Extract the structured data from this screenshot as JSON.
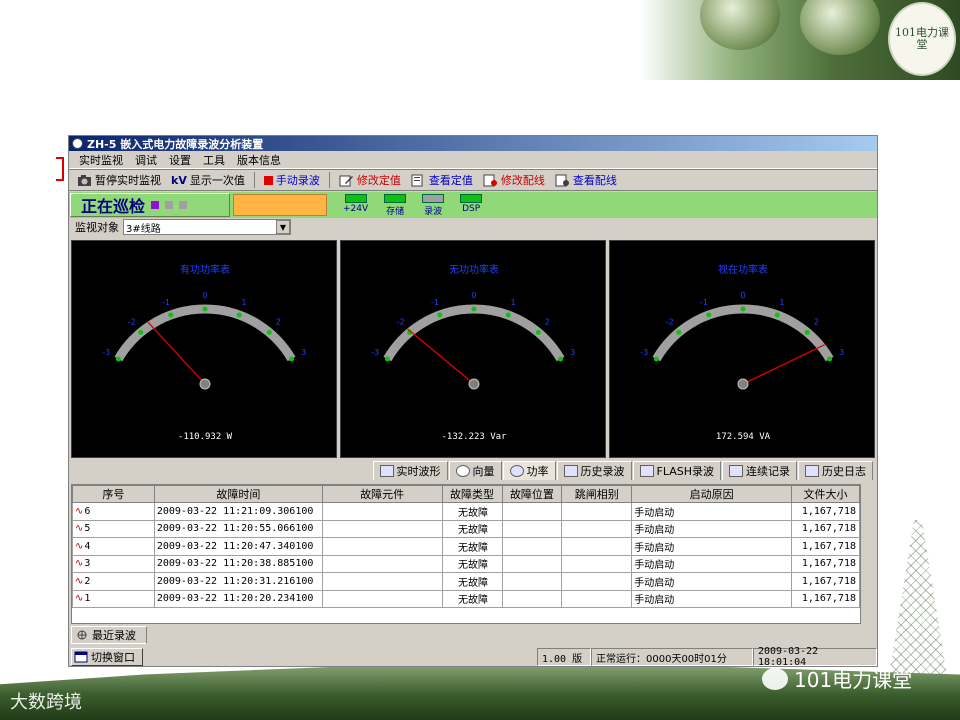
{
  "window": {
    "title": "ZH-5 嵌入式电力故障录波分析装置"
  },
  "menu": [
    "实时监视",
    "调试",
    "设置",
    "工具",
    "版本信息"
  ],
  "toolbar": {
    "pause": "暂停实时监视",
    "display": "显示一次值",
    "display_prefix": "kV",
    "manual_record": "手动录波",
    "edit_setting": "修改定值",
    "view_setting": "查看定值",
    "edit_wiring": "修改配线",
    "view_wiring": "查看配线"
  },
  "status": {
    "patrol": "正在巡检",
    "leds": [
      {
        "label": "+24V",
        "on": true
      },
      {
        "label": "存储",
        "on": true
      },
      {
        "label": "录波",
        "on": false
      },
      {
        "label": "DSP",
        "on": true
      }
    ]
  },
  "monitor": {
    "label": "监视对象",
    "selected": "3#线路"
  },
  "gauges": [
    {
      "title": "有功功率表",
      "value": -110.932,
      "readout": "-110.932 W"
    },
    {
      "title": "无功功率表",
      "value": -132.223,
      "readout": "-132.223 Var"
    },
    {
      "title": "视在功率表",
      "value": 172.594,
      "readout": "172.594 VA"
    }
  ],
  "gauge_ticks": [
    "-3",
    "-2",
    "-1",
    "0",
    "1",
    "2",
    "3"
  ],
  "tabs": [
    "实时波形",
    "向量",
    "功率",
    "历史录波",
    "FLASH录波",
    "连续记录",
    "历史日志"
  ],
  "table": {
    "headers": [
      "序号",
      "故障时间",
      "故障元件",
      "故障类型",
      "故障位置",
      "跳闸相别",
      "启动原因",
      "文件大小"
    ],
    "rows": [
      [
        "6",
        "2009-03-22 11:21:09.306100",
        "",
        "无故障",
        "",
        "",
        "手动启动",
        "1,167,718"
      ],
      [
        "5",
        "2009-03-22 11:20:55.066100",
        "",
        "无故障",
        "",
        "",
        "手动启动",
        "1,167,718"
      ],
      [
        "4",
        "2009-03-22 11:20:47.340100",
        "",
        "无故障",
        "",
        "",
        "手动启动",
        "1,167,718"
      ],
      [
        "3",
        "2009-03-22 11:20:38.885100",
        "",
        "无故障",
        "",
        "",
        "手动启动",
        "1,167,718"
      ],
      [
        "2",
        "2009-03-22 11:20:31.216100",
        "",
        "无故障",
        "",
        "",
        "手动启动",
        "1,167,718"
      ],
      [
        "1",
        "2009-03-22 11:20:20.234100",
        "",
        "无故障",
        "",
        "",
        "手动启动",
        "1,167,718"
      ]
    ]
  },
  "recent_tab": "最近录波",
  "statusbar": {
    "switch": "切换窗口",
    "version": "1.00 版",
    "runtime": "正常运行：0000天00时01分",
    "clock": "2009-03-22 18:01:04"
  },
  "slide": {
    "logo_text": "101电力课堂",
    "watermark_left": "大数跨境",
    "watermark_right": "101电力课堂"
  },
  "colors": {
    "accent": "#0a246a",
    "led_on": "#10c010",
    "needle": "#e00000",
    "gauge_arc": "#a0a0a0"
  }
}
